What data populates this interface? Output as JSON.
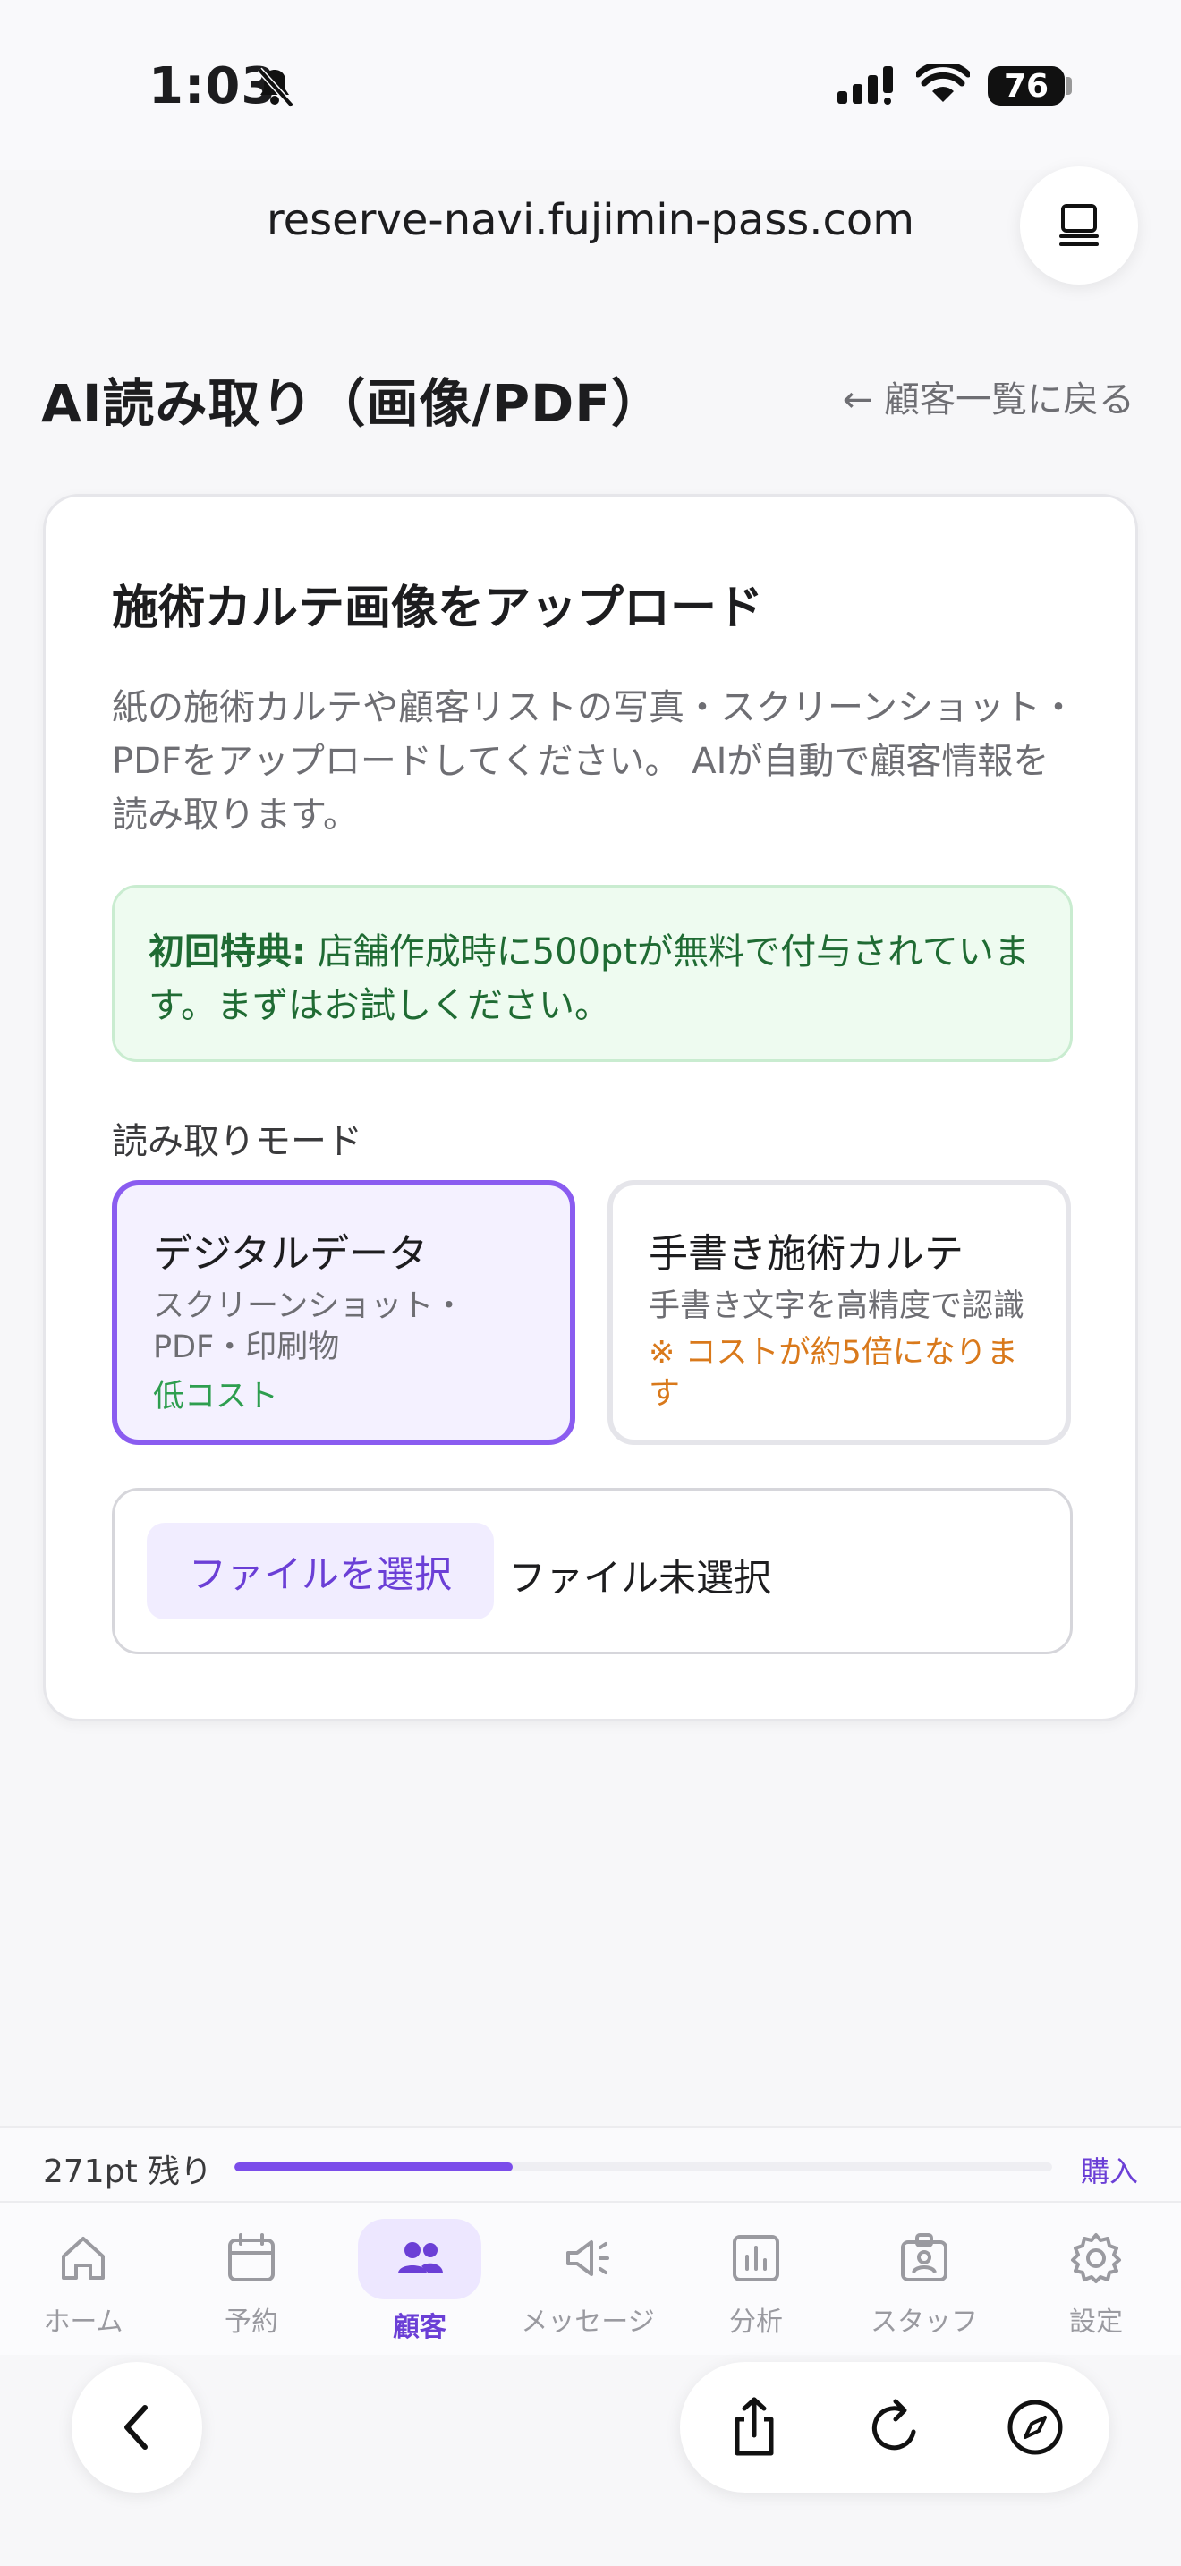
{
  "status": {
    "time": "1:03",
    "battery": "76"
  },
  "browser": {
    "url": "reserve-navi.fujimin-pass.com"
  },
  "header": {
    "title": "AI読み取り（画像/PDF）",
    "back_link": "← 顧客一覧に戻る"
  },
  "card": {
    "title": "施術カルテ画像をアップロード",
    "description": "紙の施術カルテや顧客リストの写真・スクリーンショット・PDFをアップロードしてください。 AIが自動で顧客情報を読み取ります。",
    "promo_label": "初回特典:",
    "promo_text": " 店舗作成時に500ptが無料で付与されています。まずはお試しください。",
    "mode_label": "読み取りモード",
    "modes": [
      {
        "title": "デジタルデータ",
        "sub": "スクリーンショット・PDF・印刷物",
        "note": "低コスト",
        "selected": true
      },
      {
        "title": "手書き施術カルテ",
        "sub": "手書き文字を高精度で認識",
        "note": "※ コストが約5倍になります",
        "selected": false
      }
    ],
    "file_button": "ファイルを選択",
    "file_status": "ファイル未選択"
  },
  "points": {
    "remaining": "271pt 残り",
    "fill_fraction": 0.34,
    "buy": "購入"
  },
  "nav": [
    {
      "label": "ホーム",
      "icon": "home-icon"
    },
    {
      "label": "予約",
      "icon": "calendar-icon"
    },
    {
      "label": "顧客",
      "icon": "users-icon",
      "active": true
    },
    {
      "label": "メッセージ",
      "icon": "megaphone-icon"
    },
    {
      "label": "分析",
      "icon": "chart-icon"
    },
    {
      "label": "スタッフ",
      "icon": "staff-badge-icon"
    },
    {
      "label": "設定",
      "icon": "gear-icon"
    }
  ],
  "colors": {
    "accent": "#7b4dea",
    "promo_text": "#1f6b33",
    "low_cost": "#2e9e4f",
    "warning": "#d9791b"
  }
}
